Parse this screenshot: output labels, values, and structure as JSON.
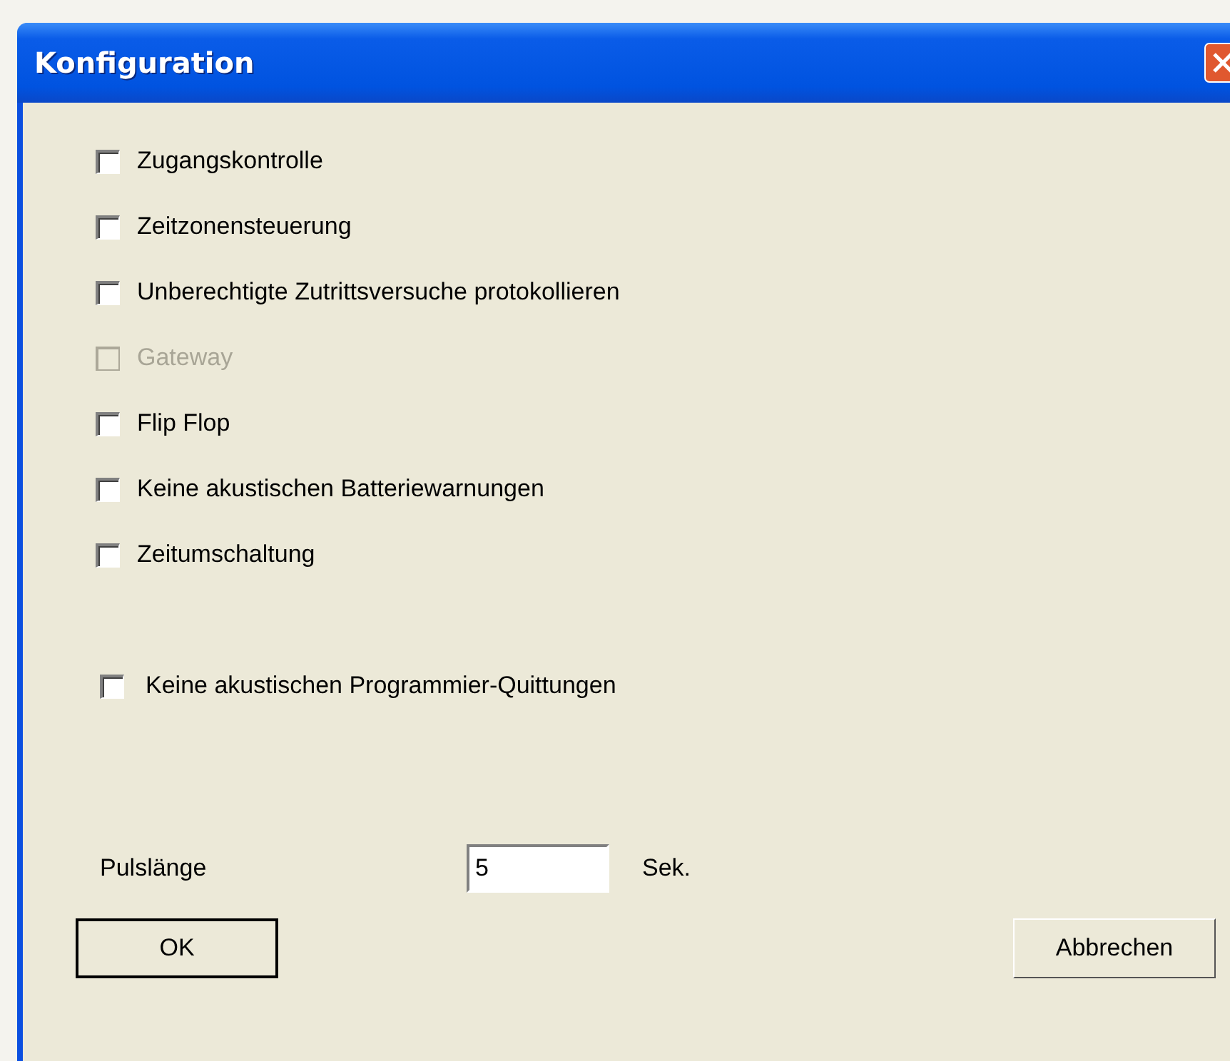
{
  "window": {
    "title": "Konfiguration"
  },
  "options": [
    {
      "label": "Zugangskontrolle",
      "checked": false,
      "disabled": false
    },
    {
      "label": "Zeitzonensteuerung",
      "checked": false,
      "disabled": false
    },
    {
      "label": "Unberechtigte Zutrittsversuche protokollieren",
      "checked": false,
      "disabled": false
    },
    {
      "label": "Gateway",
      "checked": false,
      "disabled": true
    },
    {
      "label": "Flip Flop",
      "checked": false,
      "disabled": false
    },
    {
      "label": "Keine akustischen Batteriewarnungen",
      "checked": false,
      "disabled": false
    },
    {
      "label": "Zeitumschaltung",
      "checked": false,
      "disabled": false
    }
  ],
  "extra_options": [
    {
      "label": "Keine akustischen Programmier-Quittungen",
      "checked": false,
      "disabled": false
    }
  ],
  "pulse": {
    "label": "Pulslänge",
    "value": "5",
    "unit": "Sek."
  },
  "buttons": [
    {
      "label": "OK",
      "default": true
    },
    {
      "label": "Abbrechen",
      "default": false
    }
  ]
}
